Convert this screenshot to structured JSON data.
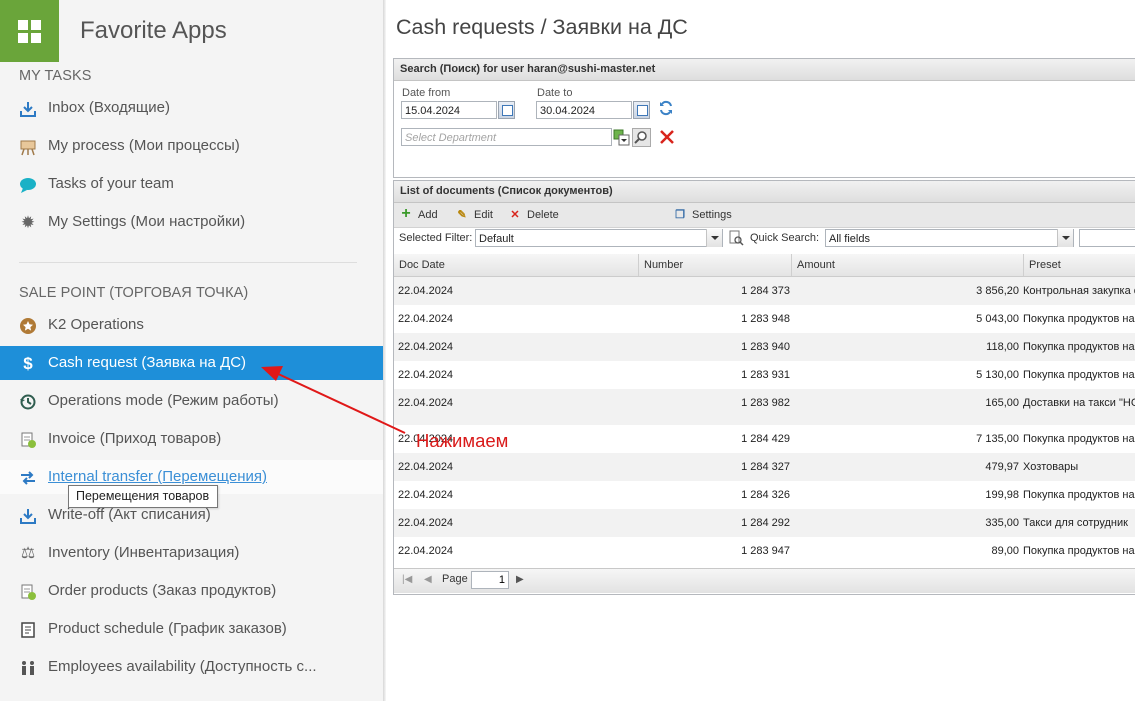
{
  "app": {
    "title": "Favorite Apps"
  },
  "sidebar": {
    "my_tasks_header": "MY TASKS",
    "my_tasks": [
      {
        "label": "Inbox (Входящие)",
        "icon": "inbox-icon"
      },
      {
        "label": "My process (Мои процессы)",
        "icon": "process-icon"
      },
      {
        "label": "Tasks of your team",
        "icon": "chat-icon"
      },
      {
        "label": "My Settings (Мои настройки)",
        "icon": "gear-icon"
      }
    ],
    "sale_point_header": "SALE POINT (ТОРГОВАЯ ТОЧКА)",
    "sale_point": [
      {
        "label": "K2 Operations",
        "icon": "star-icon"
      },
      {
        "label": "Cash request (Заявка на ДС)",
        "icon": "dollar-icon",
        "active": true
      },
      {
        "label": "Operations mode (Режим работы)",
        "icon": "history-icon"
      },
      {
        "label": "Invoice (Приход товаров)",
        "icon": "document-check-icon"
      },
      {
        "label": "Internal transfer (Перемещения)",
        "icon": "transfer-icon",
        "hover": true
      },
      {
        "label": "Write-off (Акт списания)",
        "icon": "download-icon"
      },
      {
        "label": "Inventory (Инвентаризация)",
        "icon": "scales-icon"
      },
      {
        "label": "Order products (Заказ продуктов)",
        "icon": "document-check-icon"
      },
      {
        "label": "Product schedule (График заказов)",
        "icon": "schedule-icon"
      },
      {
        "label": "Employees availability (Доступность с...",
        "icon": "people-icon"
      }
    ],
    "tooltip": "Перемещения товаров"
  },
  "main": {
    "title": "Cash requests / Заявки на ДС",
    "search": {
      "header": "Search (Поиск) for user haran@sushi-master.net",
      "date_from_label": "Date from",
      "date_from_value": "15.04.2024",
      "date_to_label": "Date to",
      "date_to_value": "30.04.2024",
      "department_placeholder": "Select Department"
    },
    "list": {
      "header": "List of documents (Список документов)",
      "toolbar": {
        "add": "Add",
        "edit": "Edit",
        "delete": "Delete",
        "settings": "Settings"
      },
      "selected_filter_label": "Selected Filter:",
      "selected_filter_value": "Default",
      "quick_search_label": "Quick Search:",
      "quick_search_value": "All fields",
      "columns": [
        "Doc Date",
        "Number",
        "Amount",
        "Preset"
      ],
      "rows": [
        {
          "date": "22.04.2024",
          "number": "1 284 373",
          "amount": "3 856,20",
          "preset": "Контрольная закупка с"
        },
        {
          "date": "22.04.2024",
          "number": "1 283 948",
          "amount": "5 043,00",
          "preset": "Покупка продуктов на"
        },
        {
          "date": "22.04.2024",
          "number": "1 283 940",
          "amount": "118,00",
          "preset": "Покупка продуктов на"
        },
        {
          "date": "22.04.2024",
          "number": "1 283 931",
          "amount": "5 130,00",
          "preset": "Покупка продуктов на"
        },
        {
          "date": "22.04.2024",
          "number": "1 283 982",
          "amount": "165,00",
          "preset": "Доставки на такси \"НС"
        },
        {
          "date": "22.04.2024",
          "number": "1 284 429",
          "amount": "7 135,00",
          "preset": "Покупка продуктов на"
        },
        {
          "date": "22.04.2024",
          "number": "1 284 327",
          "amount": "479,97",
          "preset": "Хозтовары"
        },
        {
          "date": "22.04.2024",
          "number": "1 284 326",
          "amount": "199,98",
          "preset": "Покупка продуктов на"
        },
        {
          "date": "22.04.2024",
          "number": "1 284 292",
          "amount": "335,00",
          "preset": "Такси для сотрудник"
        },
        {
          "date": "22.04.2024",
          "number": "1 283 947",
          "amount": "89,00",
          "preset": "Покупка продуктов на"
        }
      ],
      "pager": {
        "page_label": "Page",
        "page_value": "1"
      }
    }
  },
  "annotation": {
    "text": "Нажимаем",
    "color": "#d91a1a"
  },
  "colors": {
    "accent": "#1e8fd9",
    "logo": "#6aa53a"
  }
}
